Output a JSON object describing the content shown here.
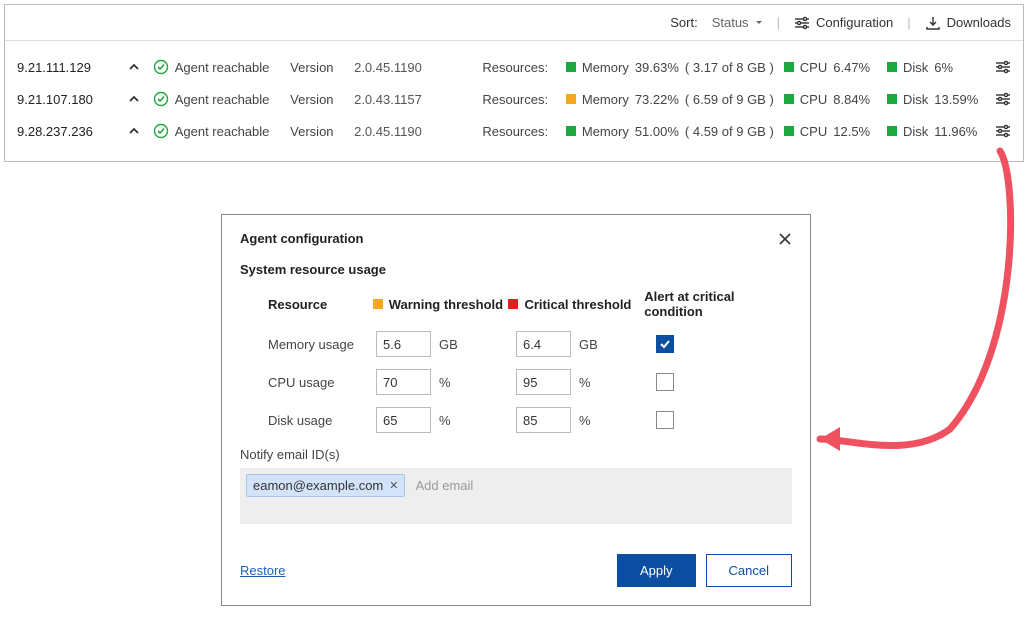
{
  "toolbar": {
    "sort_label": "Sort:",
    "sort_value": "Status",
    "configuration": "Configuration",
    "downloads": "Downloads"
  },
  "rows": [
    {
      "ip": "9.21.111.129",
      "status": "Agent reachable",
      "version_label": "Version",
      "version": "2.0.45.1190",
      "resources_label": "Resources:",
      "mem_label": "Memory",
      "mem_pct": "39.63%",
      "mem_detail": "( 3.17 of 8 GB )",
      "mem_color": "green",
      "cpu_label": "CPU",
      "cpu_pct": "6.47%",
      "disk_label": "Disk",
      "disk_pct": "6%"
    },
    {
      "ip": "9.21.107.180",
      "status": "Agent reachable",
      "version_label": "Version",
      "version": "2.0.43.1157",
      "resources_label": "Resources:",
      "mem_label": "Memory",
      "mem_pct": "73.22%",
      "mem_detail": "( 6.59 of 9 GB )",
      "mem_color": "amber",
      "cpu_label": "CPU",
      "cpu_pct": "8.84%",
      "disk_label": "Disk",
      "disk_pct": "13.59%"
    },
    {
      "ip": "9.28.237.236",
      "status": "Agent reachable",
      "version_label": "Version",
      "version": "2.0.45.1190",
      "resources_label": "Resources:",
      "mem_label": "Memory",
      "mem_pct": "51.00%",
      "mem_detail": "( 4.59 of 9 GB )",
      "mem_color": "green",
      "cpu_label": "CPU",
      "cpu_pct": "12.5%",
      "disk_label": "Disk",
      "disk_pct": "11.96%"
    }
  ],
  "dialog": {
    "title": "Agent configuration",
    "section": "System resource usage",
    "hdr_resource": "Resource",
    "hdr_warning": "Warning threshold",
    "hdr_critical": "Critical threshold",
    "hdr_alert": "Alert at critical condition",
    "rows": [
      {
        "label": "Memory usage",
        "warn": "5.6",
        "warn_unit": "GB",
        "crit": "6.4",
        "crit_unit": "GB",
        "alert": true
      },
      {
        "label": "CPU usage",
        "warn": "70",
        "warn_unit": "%",
        "crit": "95",
        "crit_unit": "%",
        "alert": false
      },
      {
        "label": "Disk usage",
        "warn": "65",
        "warn_unit": "%",
        "crit": "85",
        "crit_unit": "%",
        "alert": false
      }
    ],
    "notify_label": "Notify email ID(s)",
    "email_chip": "eamon@example.com",
    "email_placeholder": "Add email",
    "restore": "Restore",
    "apply": "Apply",
    "cancel": "Cancel"
  }
}
